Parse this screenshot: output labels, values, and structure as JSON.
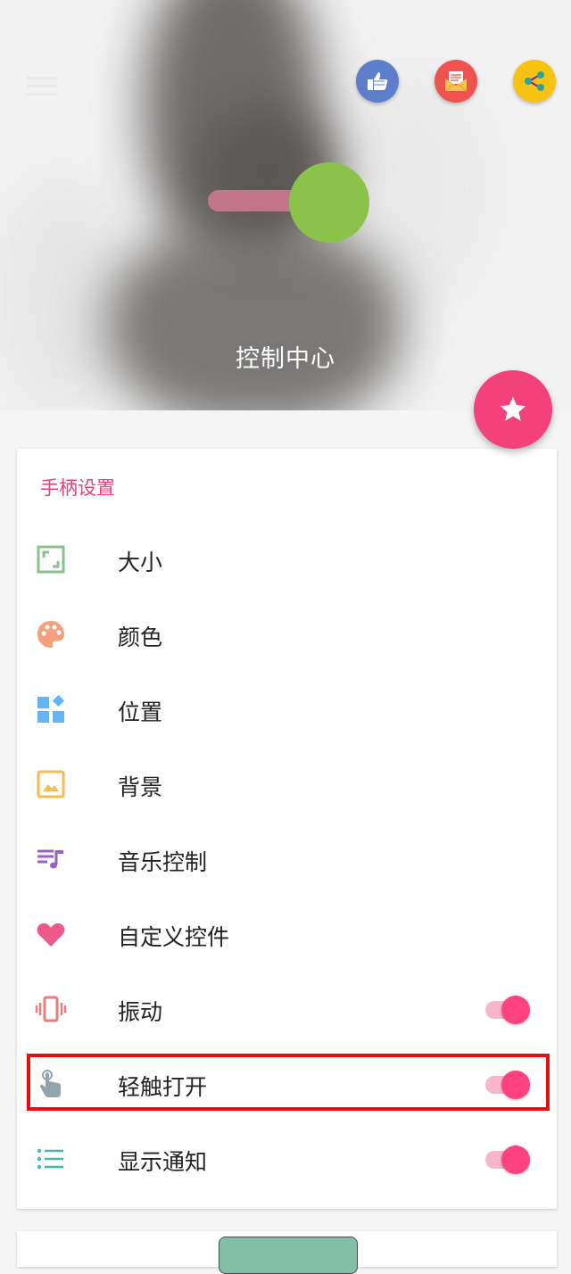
{
  "header": {
    "title": "控制中心",
    "actions": [
      {
        "name": "like-icon",
        "color": "#5c7ecb"
      },
      {
        "name": "mail-icon",
        "color": "#ef5350"
      },
      {
        "name": "share-icon",
        "color": "#f7c211"
      }
    ],
    "handle_color": "#8bc34a"
  },
  "fab": {
    "icon": "star-icon",
    "color": "#f2417b"
  },
  "settings": {
    "section_title": "手柄设置",
    "items": [
      {
        "label": "大小",
        "icon": "size-icon"
      },
      {
        "label": "颜色",
        "icon": "palette-icon"
      },
      {
        "label": "位置",
        "icon": "position-icon"
      },
      {
        "label": "背景",
        "icon": "image-icon"
      },
      {
        "label": "音乐控制",
        "icon": "music-icon"
      },
      {
        "label": "自定义控件",
        "icon": "heart-icon"
      },
      {
        "label": "振动",
        "icon": "vibrate-icon",
        "toggle": true
      },
      {
        "label": "轻触打开",
        "icon": "touch-icon",
        "toggle": true
      },
      {
        "label": "显示通知",
        "icon": "list-icon",
        "toggle": true
      }
    ]
  },
  "accent_color": "#ff4081"
}
